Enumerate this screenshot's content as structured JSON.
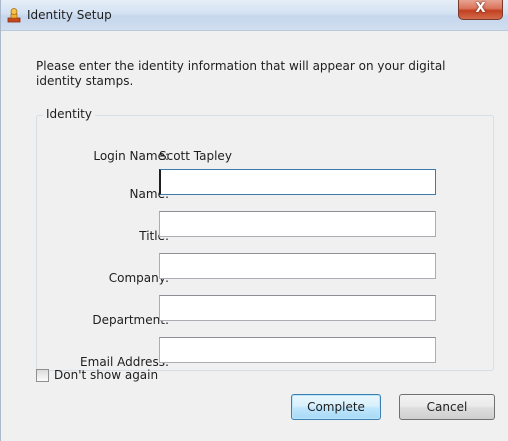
{
  "window": {
    "title": "Identity Setup",
    "close_glyph": "X",
    "app_icon": "stamp-icon"
  },
  "intro_text": "Please enter the identity information that will appear on your digital identity stamps.",
  "identity_group": {
    "legend": "Identity",
    "login_name_label": "Login Name:",
    "login_name_value": "Scott Tapley",
    "fields": [
      {
        "label": "Name:",
        "value": ""
      },
      {
        "label": "Title:",
        "value": ""
      },
      {
        "label": "Company:",
        "value": ""
      },
      {
        "label": "Department:",
        "value": ""
      },
      {
        "label": "Email Address:",
        "value": ""
      }
    ]
  },
  "footer": {
    "dont_show_again_label": "Don't show again",
    "dont_show_again_checked": false,
    "complete_label": "Complete",
    "cancel_label": "Cancel"
  },
  "colors": {
    "titlebar": "#d3e1f2",
    "close_button": "#c2401f",
    "dialog_background": "#f0f0f0",
    "default_button_accent": "#3c7fb1"
  }
}
